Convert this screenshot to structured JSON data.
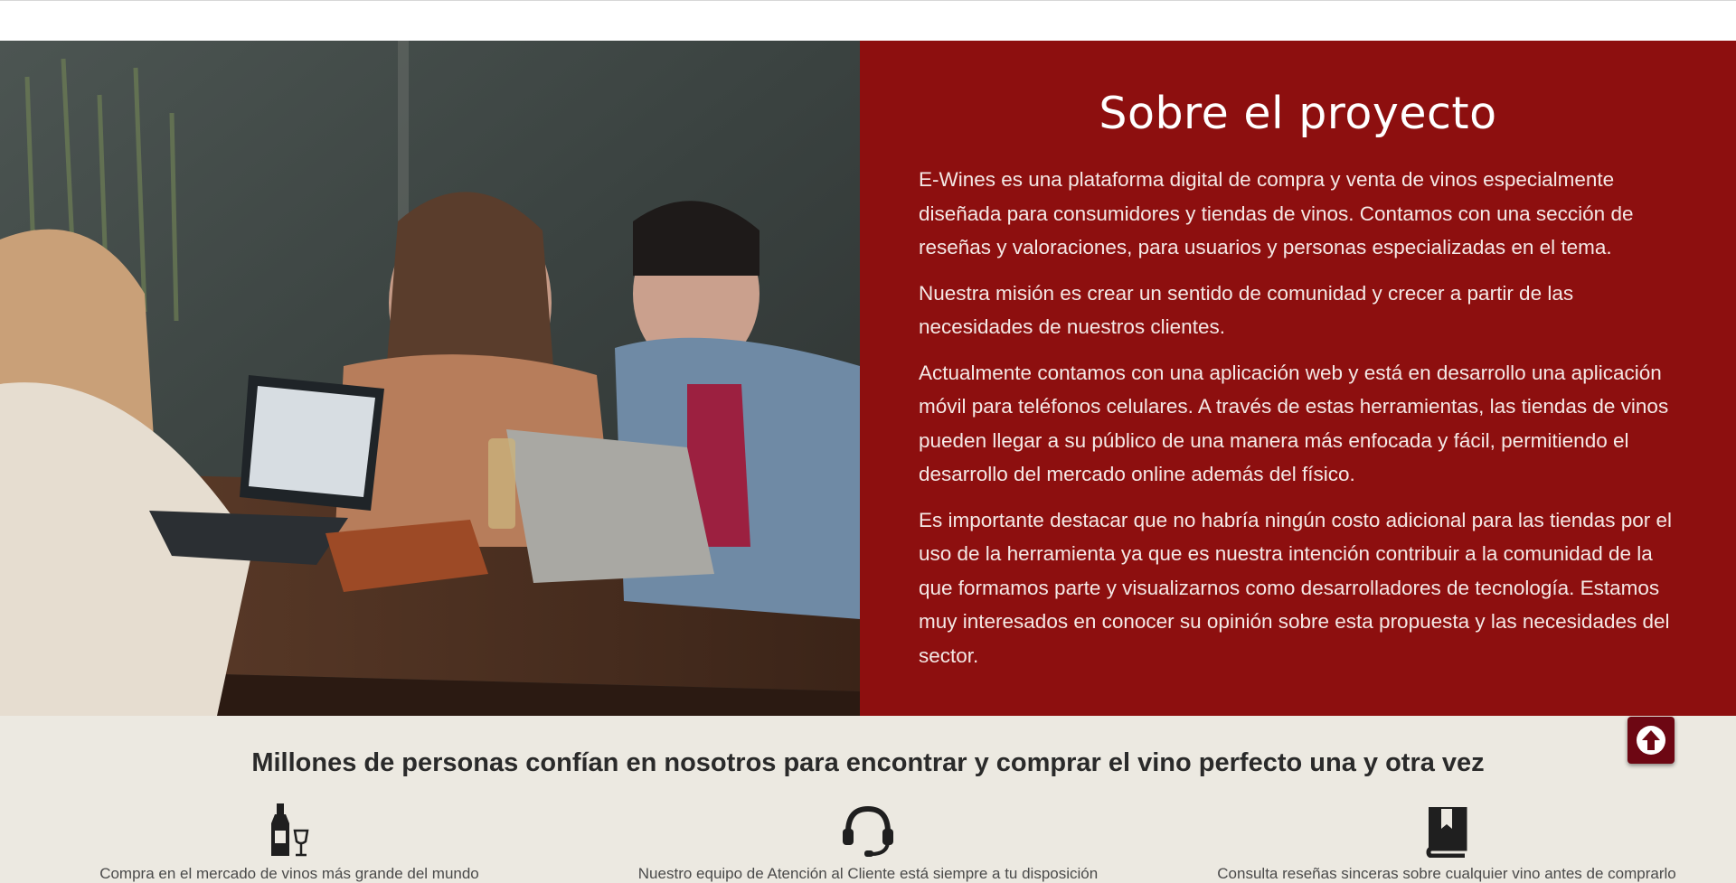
{
  "about": {
    "title": "Sobre el proyecto",
    "paragraphs": [
      "E-Wines es una plataforma digital de compra y venta de vinos especialmente diseñada para consumidores y tiendas de vinos. Contamos con una sección de reseñas y valoraciones, para usuarios y personas especializadas en el tema.",
      "Nuestra misión es crear un sentido de comunidad y crecer a partir de las necesidades de nuestros clientes.",
      "Actualmente contamos con una aplicación web y está en desarrollo una aplicación móvil para teléfonos celulares. A través de estas herramientas, las tiendas de vinos pueden llegar a su público de una manera más enfocada y fácil, permitiendo el desarrollo del mercado online además del físico.",
      "Es importante destacar que no habría ningún costo adicional para las tiendas por el uso de la herramienta ya que es nuestra intención contribuir a la comunidad de la que formamos parte y visualizarnos como desarrolladores de tecnología. Estamos muy interesados en conocer su opinión sobre esta propuesta y las necesidades del sector."
    ],
    "image_icon": "team-photo-image"
  },
  "trust": {
    "heading": "Millones de personas confían en nosotros para encontrar y comprar el vino perfecto una y otra vez",
    "features": [
      {
        "icon": "wine-bottle-glass-icon",
        "caption": "Compra en el mercado de vinos más grande del mundo"
      },
      {
        "icon": "headset-icon",
        "caption": "Nuestro equipo de Atención al Cliente está siempre a tu disposición"
      },
      {
        "icon": "book-icon",
        "caption": "Consulta reseñas sinceras sobre cualquier vino antes de comprarlo"
      }
    ]
  },
  "scroll_top": {
    "icon": "arrow-up-icon"
  },
  "colors": {
    "panel": "#8d0f0f",
    "trust_bg": "#ece9e1",
    "scroll_button": "#6d0713"
  }
}
